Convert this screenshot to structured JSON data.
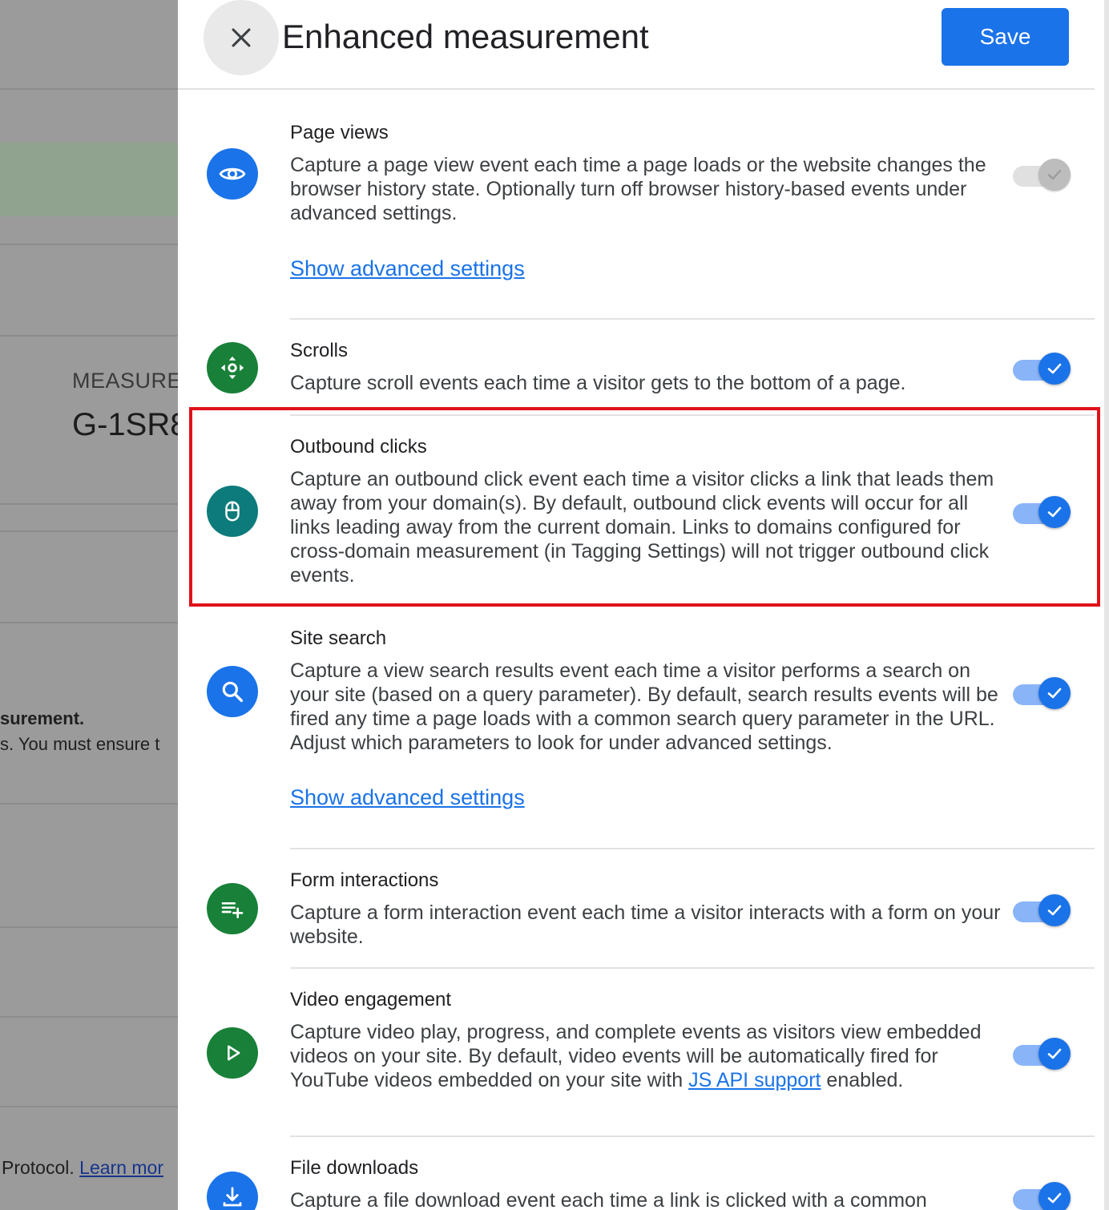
{
  "background": {
    "measurement_label": "MEASURE",
    "measurement_id": "G-1SR8",
    "text_line1": "surement.",
    "text_line2": "s. You must ensure t",
    "protocol_text": "Protocol. ",
    "learn_more": "Learn mor"
  },
  "panel": {
    "title": "Enhanced measurement",
    "save_label": "Save"
  },
  "settings": [
    {
      "title": "Page views",
      "description": "Capture a page view event each time a page loads or the website changes the browser history state. Optionally turn off browser history-based events under advanced settings.",
      "advanced_link": "Show advanced settings",
      "enabled": true,
      "locked": true,
      "icon": "eye-icon",
      "icon_color": "#1a73e8"
    },
    {
      "title": "Scrolls",
      "description": "Capture scroll events each time a visitor gets to the bottom of a page.",
      "enabled": true,
      "icon": "scroll-icon",
      "icon_color": "#188038"
    },
    {
      "title": "Outbound clicks",
      "description": "Capture an outbound click event each time a visitor clicks a link that leads them away from your domain(s). By default, outbound click events will occur for all links leading away from the current domain. Links to domains configured for cross-domain measurement (in Tagging Settings) will not trigger outbound click events.",
      "enabled": true,
      "highlighted": true,
      "icon": "mouse-icon",
      "icon_color": "#0d7b7b"
    },
    {
      "title": "Site search",
      "description": "Capture a view search results event each time a visitor performs a search on your site (based on a query parameter). By default, search results events will be fired any time a page loads with a common search query parameter in the URL. Adjust which parameters to look for under advanced settings.",
      "advanced_link": "Show advanced settings",
      "enabled": true,
      "icon": "search-icon",
      "icon_color": "#1a73e8"
    },
    {
      "title": "Form interactions",
      "description": "Capture a form interaction event each time a visitor interacts with a form on your website.",
      "enabled": true,
      "icon": "playlist-add-icon",
      "icon_color": "#188038"
    },
    {
      "title": "Video engagement",
      "description_before_link": "Capture video play, progress, and complete events as visitors view embedded videos on your site. By default, video events will be automatically fired for YouTube videos embedded on your site with ",
      "description_link": "JS API support",
      "description_after_link": " enabled.",
      "enabled": true,
      "icon": "play-icon",
      "icon_color": "#188038"
    },
    {
      "title": "File downloads",
      "description": "Capture a file download event each time a link is clicked with a common",
      "enabled": true,
      "icon": "download-icon",
      "icon_color": "#1a73e8"
    }
  ]
}
